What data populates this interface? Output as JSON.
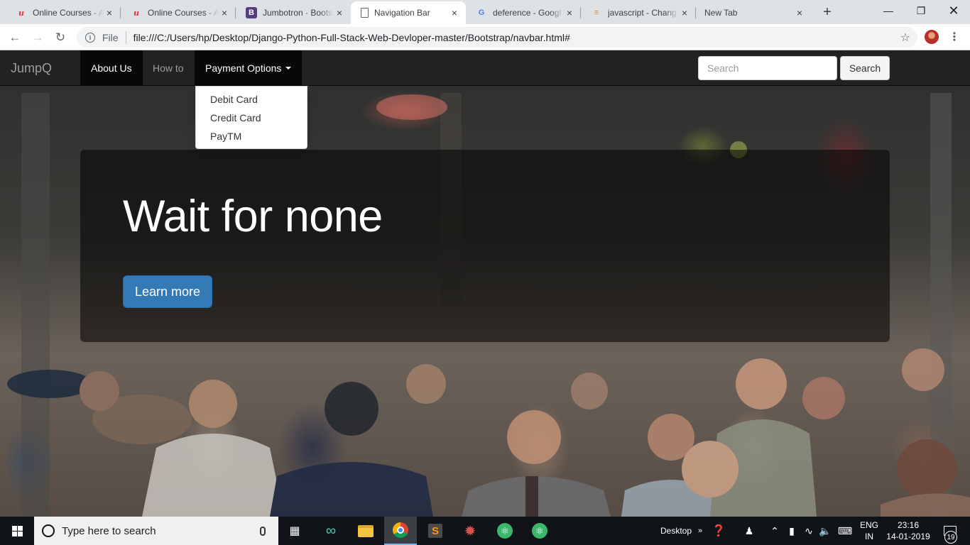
{
  "browser": {
    "tabs": [
      {
        "title": "Online Courses - A",
        "icon": "udemy-icon",
        "active": false
      },
      {
        "title": "Online Courses - A",
        "icon": "udemy-icon",
        "active": false
      },
      {
        "title": "Jumbotron · Boots",
        "icon": "bootstrap-icon",
        "active": false
      },
      {
        "title": "Navigation Bar",
        "icon": "document-icon",
        "active": true
      },
      {
        "title": "deference - Googl",
        "icon": "google-icon",
        "active": false
      },
      {
        "title": "javascript - Chang",
        "icon": "stackoverflow-icon",
        "active": false
      },
      {
        "title": "New Tab",
        "icon": "",
        "active": false
      }
    ],
    "address": {
      "scheme_label": "File",
      "url": "file:///C:/Users/hp/Desktop/Django-Python-Full-Stack-Web-Devloper-master/Bootstrap/navbar.html#"
    }
  },
  "page": {
    "navbar": {
      "brand": "JumpQ",
      "items": [
        {
          "label": "About Us",
          "active": true
        },
        {
          "label": "How to",
          "active": false
        },
        {
          "label": "Payment Options",
          "active": true,
          "dropdown": true
        }
      ],
      "search": {
        "placeholder": "Search",
        "value": "",
        "button_label": "Search"
      }
    },
    "dropdown": {
      "items": [
        "Debit Card",
        "Credit Card",
        "PayTM"
      ]
    },
    "jumbotron": {
      "heading": "Wait for none",
      "button_label": "Learn more"
    },
    "colors": {
      "navbar_bg": "#222222",
      "primary_button": "#337ab7"
    }
  },
  "taskbar": {
    "search_placeholder": "Type here to search",
    "desktop_label": "Desktop",
    "language": {
      "line1": "ENG",
      "line2": "IN"
    },
    "clock": {
      "time": "23:16",
      "date": "14-01-2019"
    },
    "notification_count": "19"
  }
}
